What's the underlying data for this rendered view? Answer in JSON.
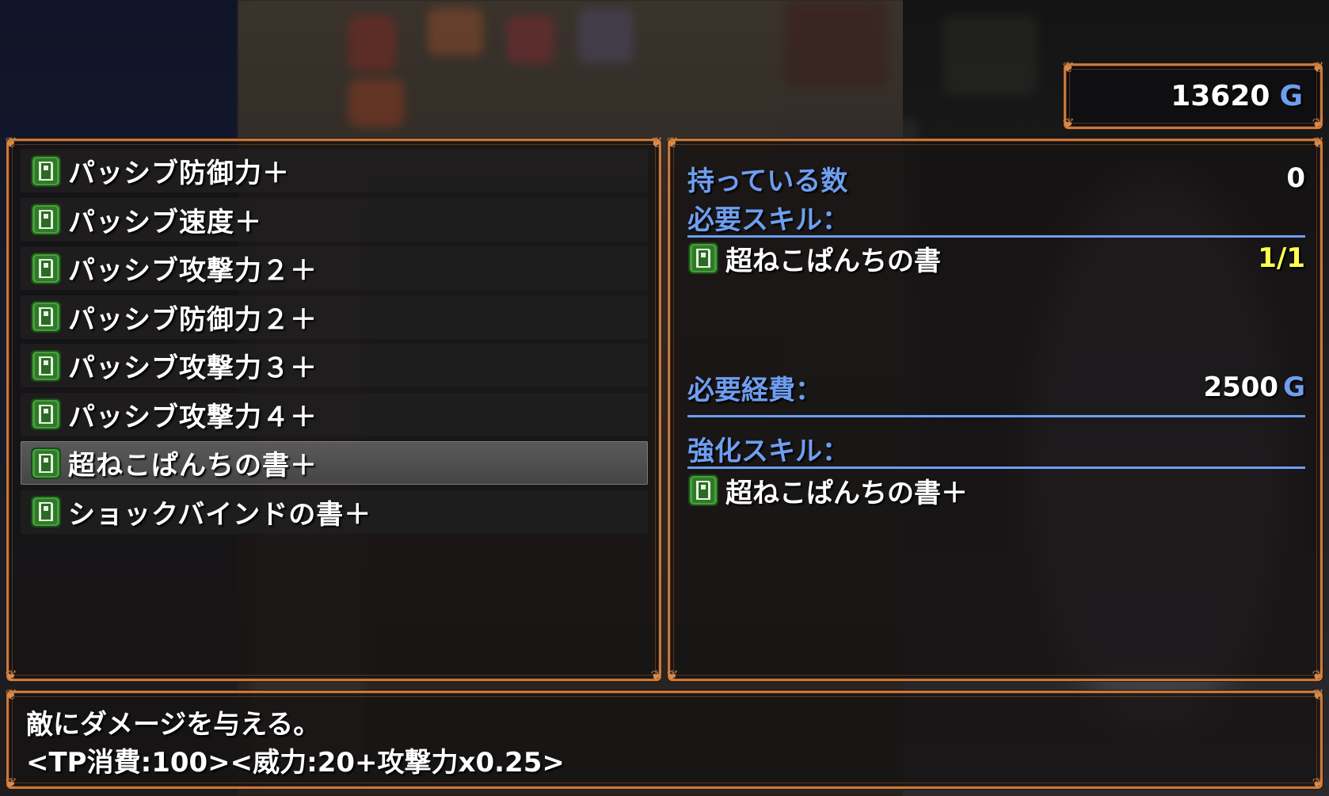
{
  "gold": {
    "amount": "13620",
    "unit": "G"
  },
  "skill_list": {
    "items": [
      {
        "label": "パッシブ防御力＋",
        "icon": "green-book-icon"
      },
      {
        "label": "パッシブ速度＋",
        "icon": "green-book-icon"
      },
      {
        "label": "パッシブ攻撃力２＋",
        "icon": "green-book-icon"
      },
      {
        "label": "パッシブ防御力２＋",
        "icon": "green-book-icon"
      },
      {
        "label": "パッシブ攻撃力３＋",
        "icon": "green-book-icon"
      },
      {
        "label": "パッシブ攻撃力４＋",
        "icon": "green-book-icon"
      },
      {
        "label": "超ねこぱんちの書＋",
        "icon": "green-book-icon",
        "selected": true
      },
      {
        "label": "ショックバインドの書＋",
        "icon": "green-book-icon"
      }
    ]
  },
  "detail": {
    "owned_label": "持っている数",
    "owned_value": "0",
    "required_skill_label": "必要スキル：",
    "required_skill": {
      "name": "超ねこぱんちの書",
      "count": "1/1",
      "icon": "green-book-icon"
    },
    "cost_label": "必要経費：",
    "cost_value": "2500",
    "cost_unit": "G",
    "upgrade_skill_label": "強化スキル：",
    "upgrade_skill": {
      "name": "超ねこぱんちの書＋",
      "icon": "green-book-icon"
    }
  },
  "help": {
    "line1": "敵にダメージを与える。",
    "line2": "<TP消費:100><威力:20+攻撃力x0.25>"
  },
  "colors": {
    "frame": "#c4793e",
    "system_blue": "#6f9ef0",
    "count_yellow": "#ffff50",
    "selected_row": "#555555"
  }
}
